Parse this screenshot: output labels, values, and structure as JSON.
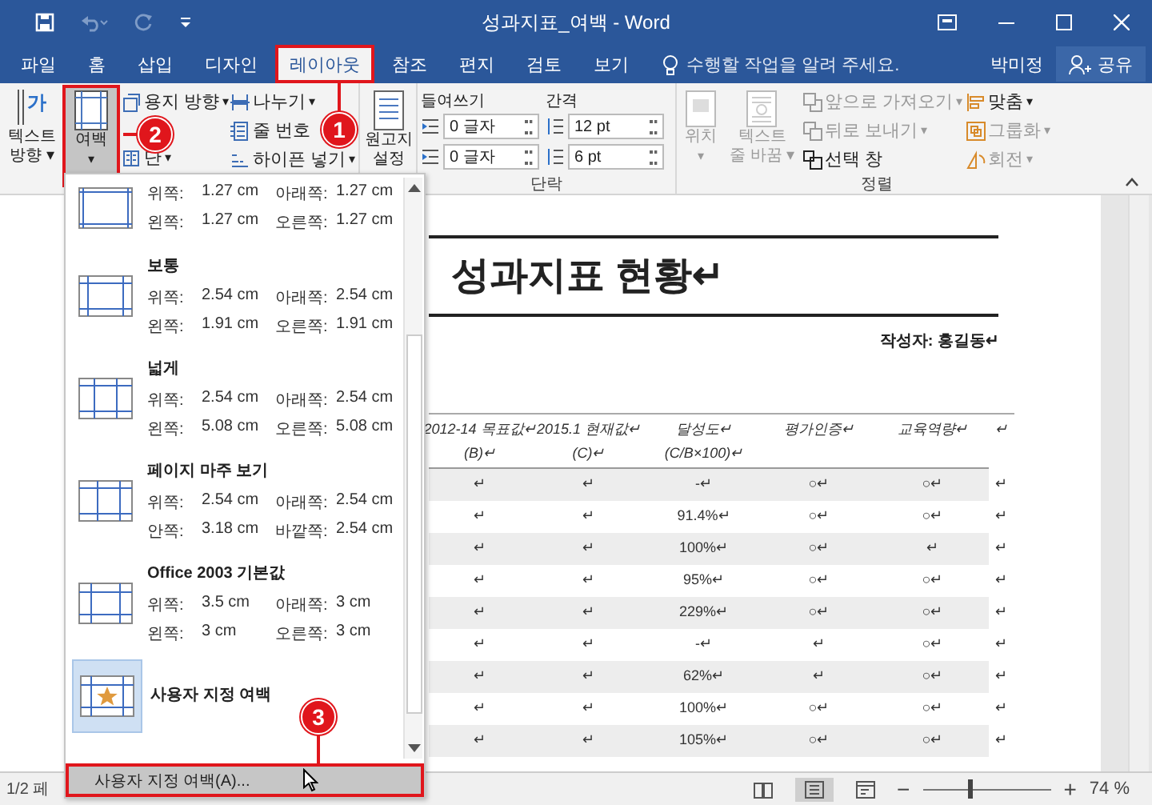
{
  "window": {
    "title": "성과지표_여백 - Word"
  },
  "tabs": [
    {
      "label": "파일",
      "selected": false,
      "boxed": false
    },
    {
      "label": "홈",
      "selected": false,
      "boxed": false
    },
    {
      "label": "삽입",
      "selected": false,
      "boxed": false
    },
    {
      "label": "디자인",
      "selected": false,
      "boxed": false
    },
    {
      "label": "레이아웃",
      "selected": true,
      "boxed": true
    },
    {
      "label": "참조",
      "selected": false,
      "boxed": false
    },
    {
      "label": "편지",
      "selected": false,
      "boxed": false
    },
    {
      "label": "검토",
      "selected": false,
      "boxed": false
    },
    {
      "label": "보기",
      "selected": false,
      "boxed": false
    }
  ],
  "tell_me": {
    "placeholder": "수행할 작업을 알려 주세요."
  },
  "user": "박미정",
  "share": "공유",
  "ribbon": {
    "text_direction": {
      "glyph": "가",
      "lines": [
        "텍스트",
        "방향 ▾"
      ]
    },
    "margins_button": {
      "label": "여백",
      "caret": "▾",
      "selected": true,
      "boxed": true
    },
    "page_setup_left": [
      {
        "kind": "orientation",
        "label": "용지 방향",
        "caret": "▾"
      },
      {
        "kind": "columns",
        "label": "단",
        "caret": "▾"
      }
    ],
    "page_setup_right": [
      {
        "kind": "breaks",
        "label": "나누기",
        "caret": "▾"
      },
      {
        "kind": "lines",
        "label": "줄 번호"
      },
      {
        "kind": "hyphen",
        "label": "하이픈 넣기",
        "caret": "▾"
      }
    ],
    "manuscript": {
      "lines": [
        "원고지",
        "설정"
      ]
    },
    "paragraph": {
      "indent_label": "들여쓰기",
      "spacing_label": "간격",
      "indent": [
        "0 글자",
        "0 글자"
      ],
      "spacing": [
        "12 pt",
        "6 pt"
      ],
      "group_label": "단락"
    },
    "arrange": {
      "position": {
        "label": "위치",
        "caret": "▾",
        "disabled": true
      },
      "wrap": {
        "lines": [
          "텍스트",
          "줄 바꿈 ▾"
        ],
        "disabled": true
      },
      "middle": [
        {
          "kind": "bring",
          "label": "앞으로 가져오기",
          "caret": "▾",
          "disabled": true
        },
        {
          "kind": "send",
          "label": "뒤로 보내기",
          "caret": "▾",
          "disabled": true
        },
        {
          "kind": "pane",
          "label": "선택 창",
          "disabled": false
        }
      ],
      "right": [
        {
          "kind": "align",
          "label": "맞춤",
          "caret": "▾",
          "disabled": false
        },
        {
          "kind": "group",
          "label": "그룹화",
          "caret": "▾",
          "disabled": true
        },
        {
          "kind": "rotate",
          "label": "회전",
          "caret": "▾",
          "disabled": true
        }
      ],
      "group_label": "정렬"
    }
  },
  "margins_menu": {
    "items": [
      {
        "kind": "narrow",
        "selected": false,
        "rows": [
          [
            "위쪽:",
            "1.27 cm",
            "아래쪽:",
            "1.27 cm"
          ],
          [
            "왼쪽:",
            "1.27 cm",
            "오른쪽:",
            "1.27 cm"
          ]
        ]
      },
      {
        "kind": "normal",
        "name": "보통",
        "selected": false,
        "rows": [
          [
            "위쪽:",
            "2.54 cm",
            "아래쪽:",
            "2.54 cm"
          ],
          [
            "왼쪽:",
            "1.91 cm",
            "오른쪽:",
            "1.91 cm"
          ]
        ]
      },
      {
        "kind": "wide",
        "name": "넓게",
        "selected": false,
        "rows": [
          [
            "위쪽:",
            "2.54 cm",
            "아래쪽:",
            "2.54 cm"
          ],
          [
            "왼쪽:",
            "5.08 cm",
            "오른쪽:",
            "5.08 cm"
          ]
        ]
      },
      {
        "kind": "mirrored",
        "name": "페이지 마주 보기",
        "selected": false,
        "rows": [
          [
            "위쪽:",
            "2.54 cm",
            "아래쪽:",
            "2.54 cm"
          ],
          [
            "안쪽:",
            "3.18 cm",
            "바깥쪽:",
            "2.54 cm"
          ]
        ]
      },
      {
        "kind": "office2003",
        "name": "Office 2003 기본값",
        "selected": false,
        "rows": [
          [
            "위쪽:",
            "3.5 cm",
            "아래쪽:",
            "3 cm"
          ],
          [
            "왼쪽:",
            "3 cm",
            "오른쪽:",
            "3 cm"
          ]
        ]
      },
      {
        "kind": "custom",
        "name": "사용자 지정 여백",
        "selected": true
      }
    ],
    "footer": {
      "label": "사용자 지정 여백(A)...",
      "boxed": true
    }
  },
  "callouts": [
    "1",
    "2",
    "3"
  ],
  "document": {
    "title": "성과지표  현황↵",
    "author": "작성자: 홍길동↵",
    "table": {
      "header": [
        [
          "2012-14 목표값↵",
          "(B)↵"
        ],
        [
          "2015.1 현재값↵",
          "(C)↵"
        ],
        [
          "달성도↵",
          "(C/B×100)↵"
        ],
        [
          "평가인증↵"
        ],
        [
          "교육역량↵"
        ],
        [
          "↵"
        ]
      ],
      "rows": [
        [
          "↵",
          "↵",
          "-↵",
          "○↵",
          "○↵",
          "↵"
        ],
        [
          "↵",
          "↵",
          "91.4%↵",
          "○↵",
          "○↵",
          "↵"
        ],
        [
          "↵",
          "↵",
          "100%↵",
          "○↵",
          "↵",
          "↵"
        ],
        [
          "↵",
          "↵",
          "95%↵",
          "○↵",
          "○↵",
          "↵"
        ],
        [
          "↵",
          "↵",
          "229%↵",
          "○↵",
          "○↵",
          "↵"
        ],
        [
          "↵",
          "↵",
          "-↵",
          "↵",
          "○↵",
          "↵"
        ],
        [
          "↵",
          "↵",
          "62%↵",
          "↵",
          "○↵",
          "↵"
        ],
        [
          "↵",
          "↵",
          "100%↵",
          "○↵",
          "○↵",
          "↵"
        ],
        [
          "↵",
          "↵",
          "105%↵",
          "○↵",
          "○↵",
          "↵"
        ]
      ]
    }
  },
  "status_bar": {
    "page": "1/2 페",
    "views": [
      {
        "kind": "read",
        "selected": false
      },
      {
        "kind": "print",
        "selected": true
      },
      {
        "kind": "web",
        "selected": false
      }
    ],
    "zoom": {
      "minus": "−",
      "plus": "+",
      "level": 0.37,
      "reading": "74 %"
    }
  }
}
